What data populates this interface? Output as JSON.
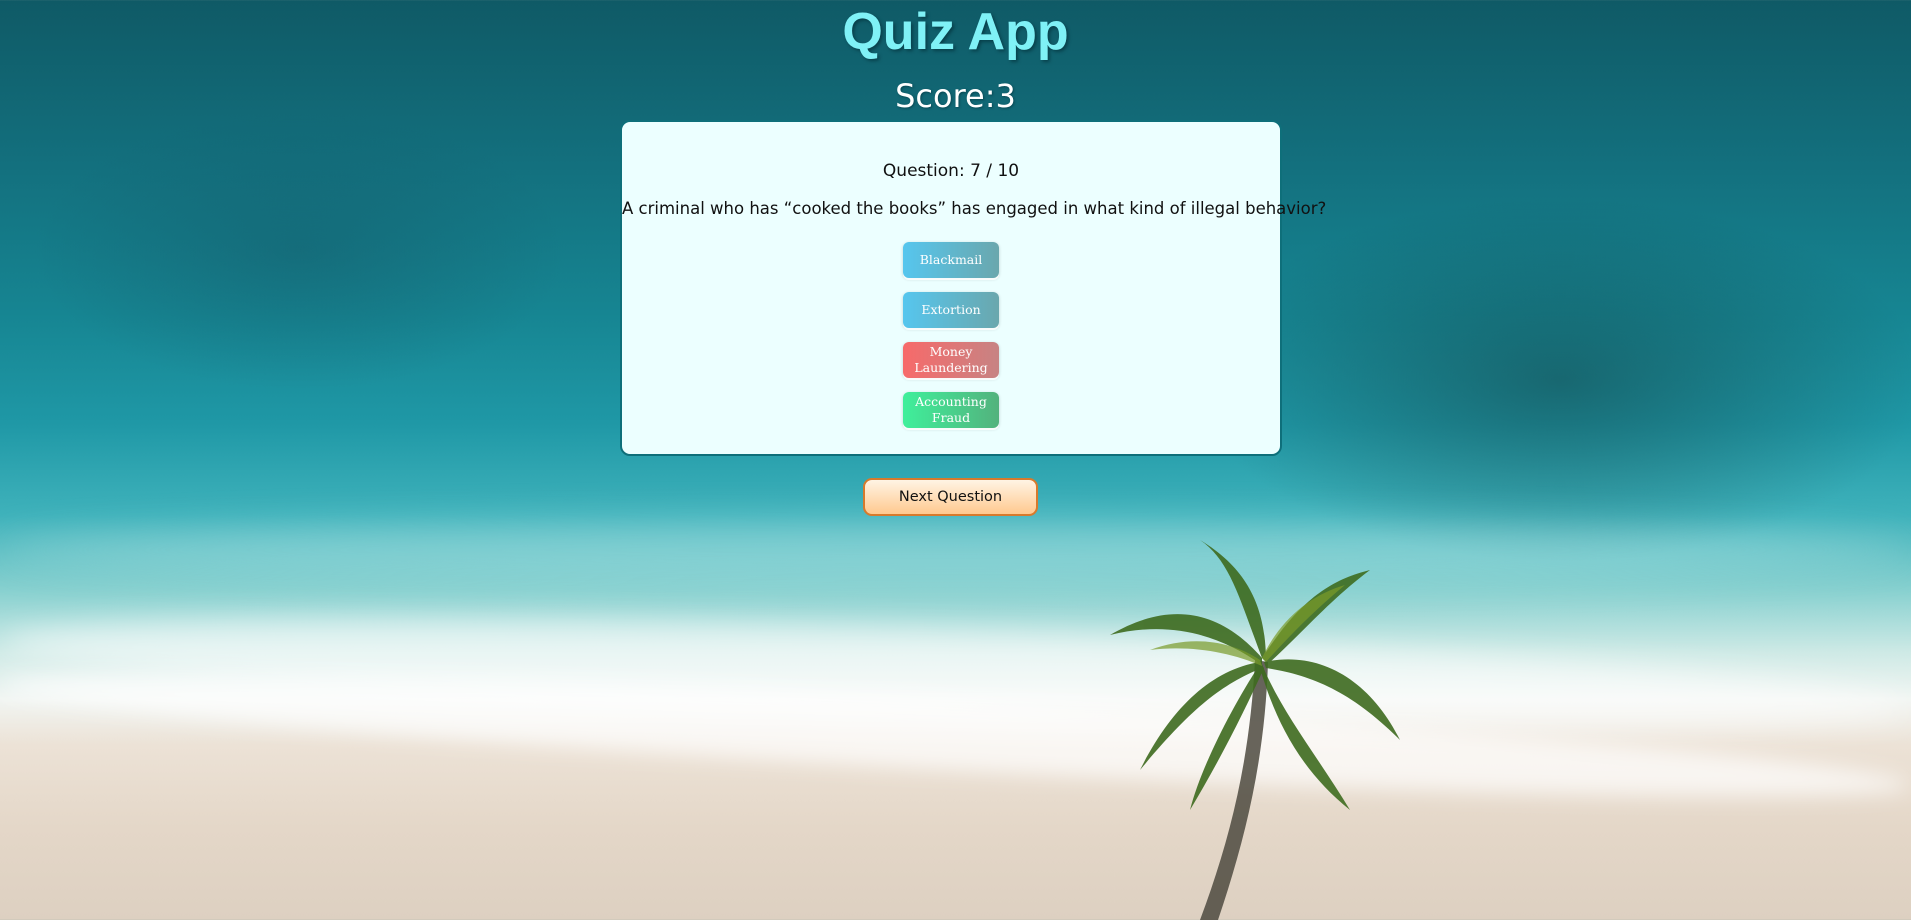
{
  "app": {
    "title": "Quiz App"
  },
  "score": {
    "label": "Score:",
    "value": "3"
  },
  "quiz": {
    "progress": "Question: 7 / 10",
    "question": "A criminal who has “cooked the books” has engaged in what kind of illegal behavior?",
    "answers": [
      {
        "label": "Blackmail",
        "state": "neutral"
      },
      {
        "label": "Extortion",
        "state": "neutral"
      },
      {
        "label": "Money Laundering",
        "state": "wrong"
      },
      {
        "label": "Accounting Fraud",
        "state": "correct"
      }
    ]
  },
  "controls": {
    "next_label": "Next Question"
  },
  "colors": {
    "title": "#7ff1f6",
    "card_bg": "#ecffff",
    "card_border": "#0e6f7a",
    "neutral": "#56c6ee",
    "wrong": "#f76a6a",
    "correct": "#3fef9b",
    "next_border": "#d77a2c"
  }
}
